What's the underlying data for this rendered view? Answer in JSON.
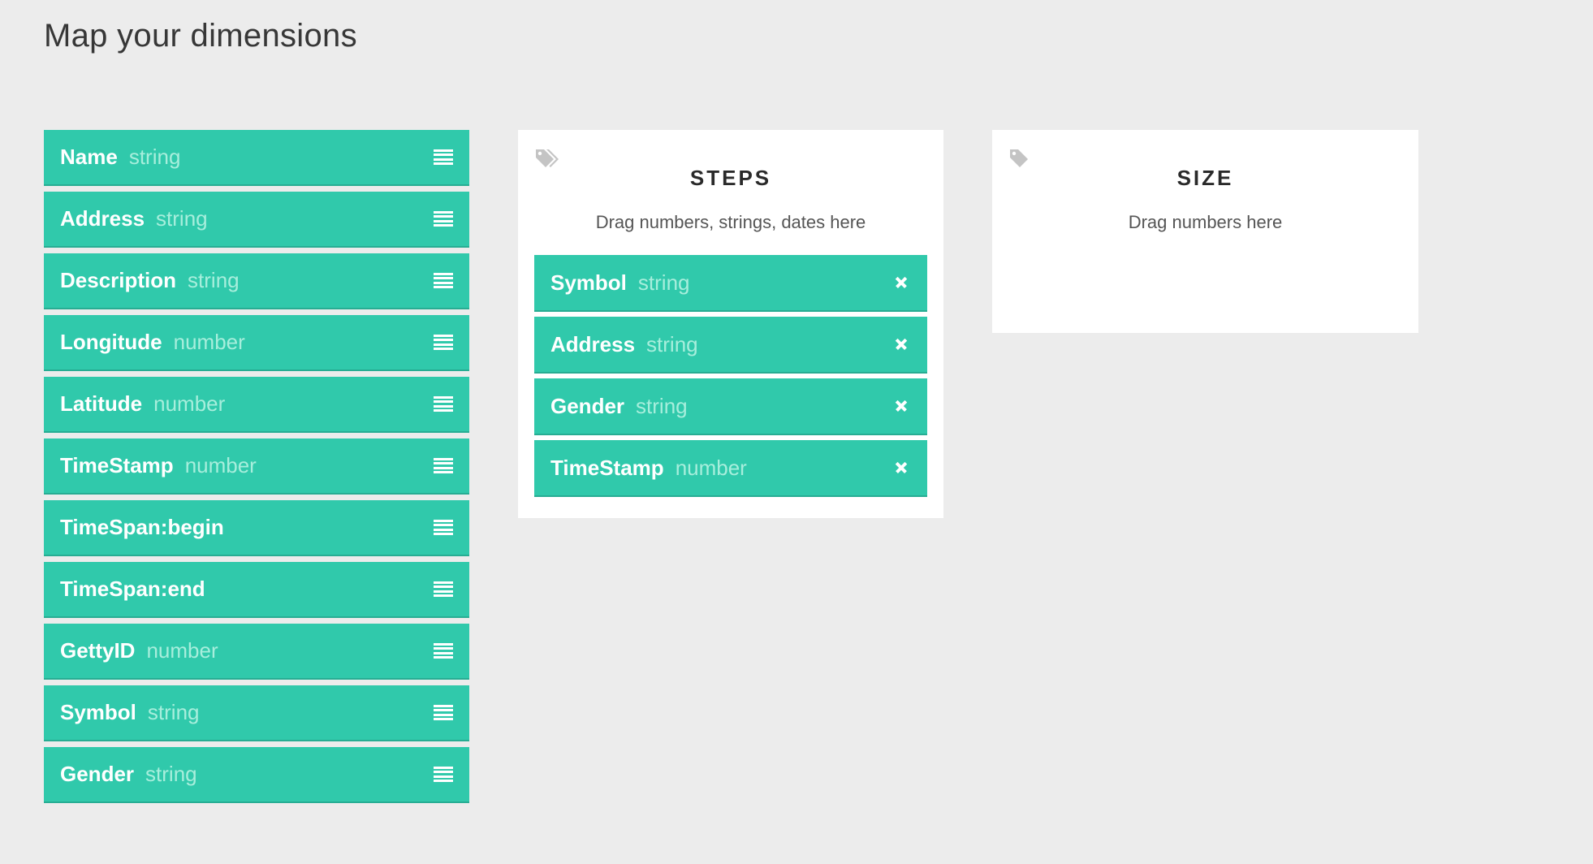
{
  "page": {
    "title": "Map your dimensions"
  },
  "dimensions": [
    {
      "name": "Name",
      "type": "string"
    },
    {
      "name": "Address",
      "type": "string"
    },
    {
      "name": "Description",
      "type": "string"
    },
    {
      "name": "Longitude",
      "type": "number"
    },
    {
      "name": "Latitude",
      "type": "number"
    },
    {
      "name": "TimeStamp",
      "type": "number"
    },
    {
      "name": "TimeSpan:begin",
      "type": ""
    },
    {
      "name": "TimeSpan:end",
      "type": ""
    },
    {
      "name": "GettyID",
      "type": "number"
    },
    {
      "name": "Symbol",
      "type": "string"
    },
    {
      "name": "Gender",
      "type": "string"
    }
  ],
  "steps": {
    "title": "STEPS",
    "hint": "Drag numbers, strings, dates here",
    "items": [
      {
        "name": "Symbol",
        "type": "string"
      },
      {
        "name": "Address",
        "type": "string"
      },
      {
        "name": "Gender",
        "type": "string"
      },
      {
        "name": "TimeStamp",
        "type": "number"
      }
    ]
  },
  "size": {
    "title": "SIZE",
    "hint": "Drag numbers here"
  },
  "icons": {
    "drag_handle": "hamburger-icon",
    "remove": "close-icon",
    "tags": "tags-icon",
    "tag": "tag-icon"
  },
  "colors": {
    "background": "#ececec",
    "item_green": "#30c9ab",
    "item_type_text": "#a7eedc",
    "card": "#ffffff",
    "icon_gray": "#c4c4c4"
  }
}
